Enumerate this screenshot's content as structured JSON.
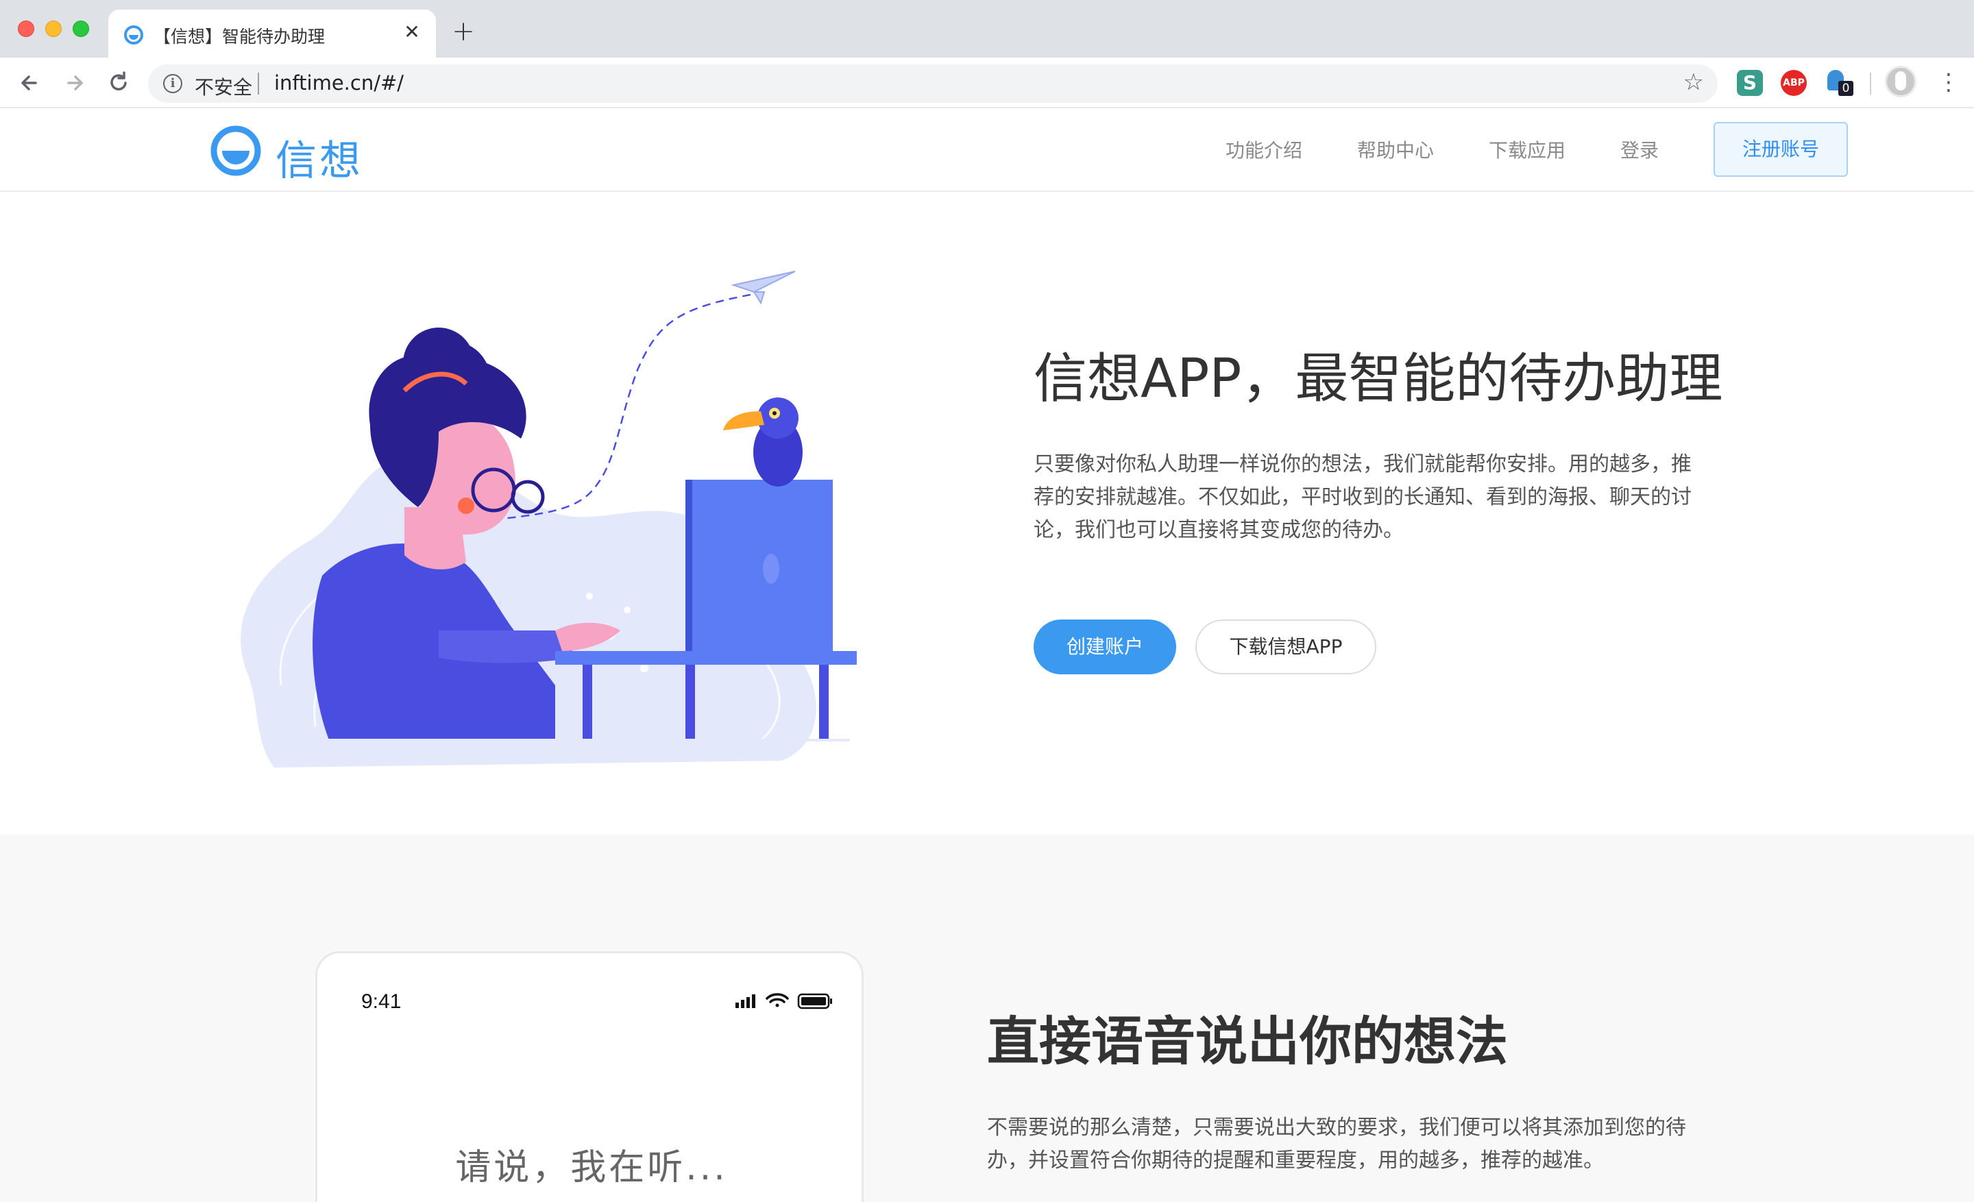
{
  "browser": {
    "tab_title": "【信想】智能待办助理",
    "tab_close": "✕",
    "new_tab": "+",
    "security_label": "不安全",
    "url": "inftime.cn/#/",
    "extensions": {
      "s_label": "S",
      "abp_label": "ABP",
      "ghost_badge": "0"
    }
  },
  "header": {
    "logo_text": "信想",
    "nav": [
      "功能介绍",
      "帮助中心",
      "下载应用",
      "登录"
    ],
    "register_label": "注册账号"
  },
  "hero": {
    "title": "信想APP，最智能的待办助理",
    "description": "只要像对你私人助理一样说你的想法，我们就能帮你安排。用的越多，推荐的安排就越准。不仅如此，平时收到的长通知、看到的海报、聊天的讨论，我们也可以直接将其变成您的待办。",
    "primary_button": "创建账户",
    "secondary_button": "下载信想APP"
  },
  "feature": {
    "phone_time": "9:41",
    "phone_prompt": "请说，我在听...",
    "title": "直接语音说出你的想法",
    "description": "不需要说的那么清楚，只需要说出大致的要求，我们便可以将其添加到您的待办，并设置符合你期待的提醒和重要程度，用的越多，推荐的越准。"
  },
  "colors": {
    "brand": "#3b99ef",
    "illustration_primary": "#4a4ee0",
    "illustration_bg": "#e4e8fb",
    "skin": "#f7a4c4"
  }
}
